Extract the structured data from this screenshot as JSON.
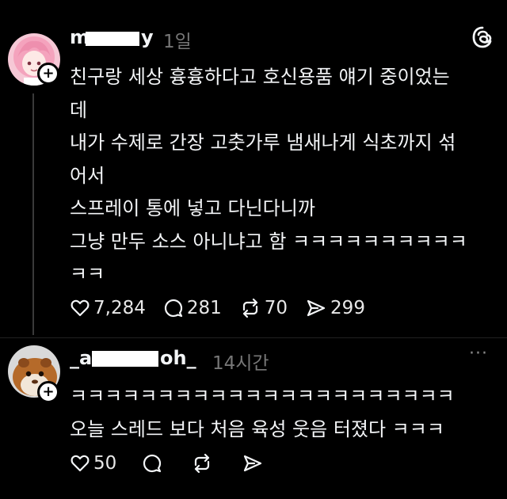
{
  "post1": {
    "username_start": "m",
    "username_end": "y",
    "time": "1일",
    "lines": [
      "친구랑 세상 흉흉하다고 호신용품 얘기 중이었는",
      "데",
      "내가 수제로 간장 고춧가루 냄새나게 식초까지 섞",
      "어서",
      "스프레이 통에 넣고 다닌다니까",
      "그냥 만두 소스 아니냐고 함 ㅋㅋㅋㅋㅋㅋㅋㅋㅋㅋ",
      "ㅋㅋ"
    ],
    "likes": "7,284",
    "replies": "281",
    "reposts": "70",
    "shares": "299"
  },
  "post2": {
    "username_start": "_a",
    "username_end": "oh_",
    "time": "14시간",
    "more": "···",
    "lines": [
      "ㅋㅋㅋㅋㅋㅋㅋㅋㅋㅋㅋㅋㅋㅋㅋㅋㅋㅋㅋㅋㅋㅋ",
      "오늘 스레드 보다 처음 육성 웃음 터졌다 ㅋㅋㅋ"
    ],
    "likes": "50"
  },
  "icons": {
    "app_logo": "threads-icon",
    "like": "heart-icon",
    "reply": "comment-icon",
    "repost": "repost-icon",
    "share": "send-icon",
    "follow": "plus-icon"
  },
  "colors": {
    "background": "#000000",
    "text": "#f3f5f7",
    "muted": "#777777"
  }
}
